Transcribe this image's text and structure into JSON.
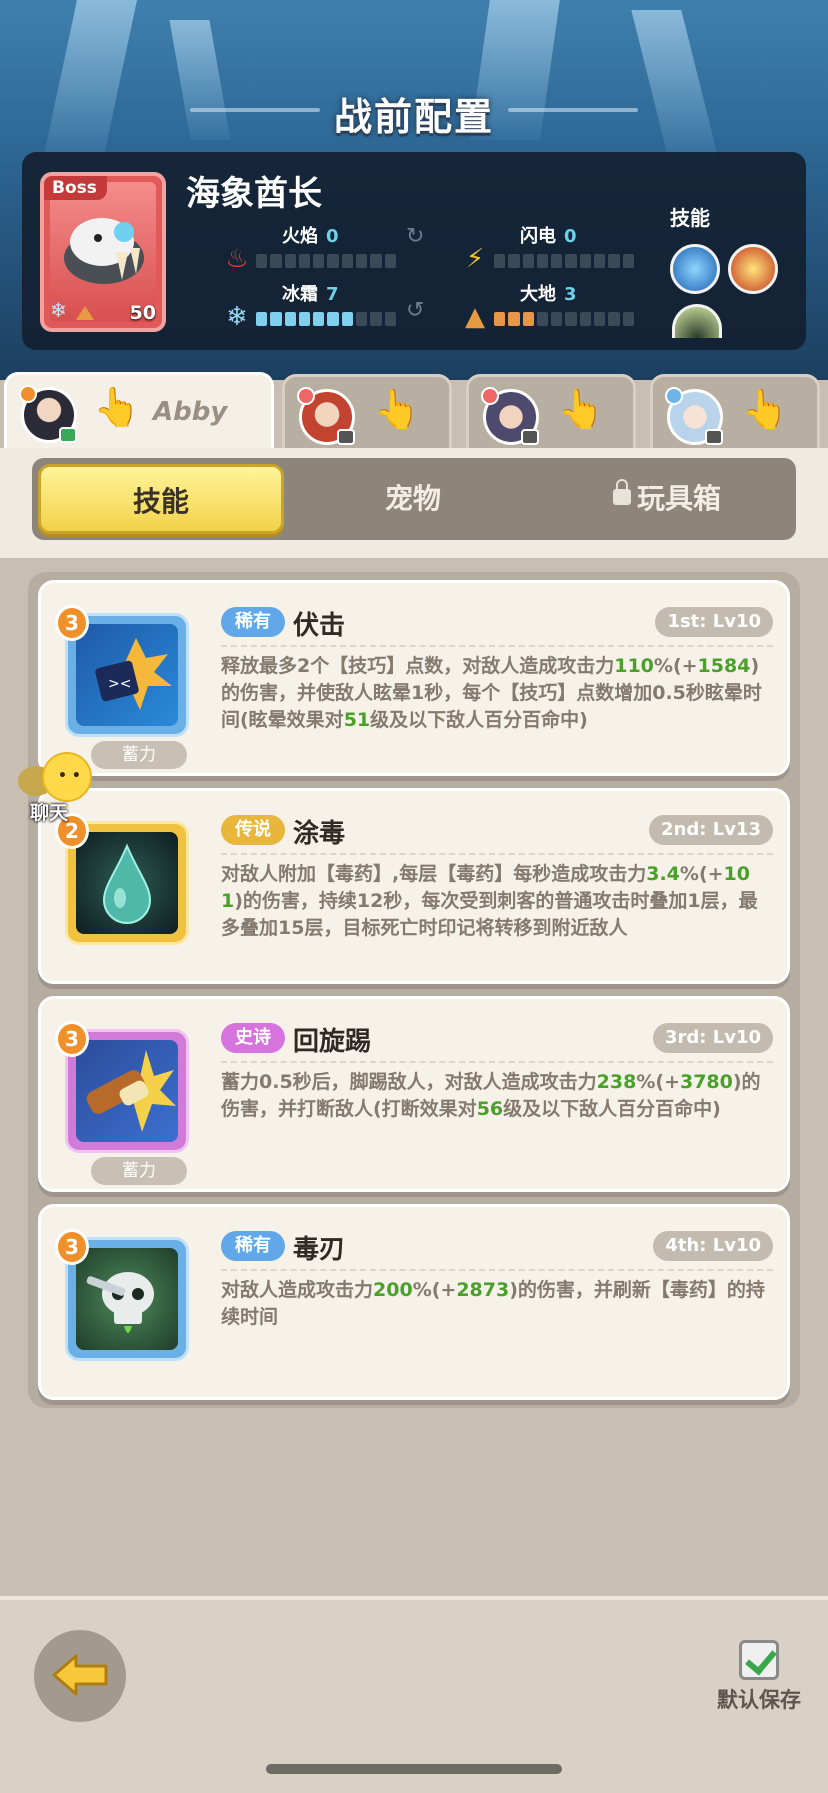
{
  "screen": {
    "title": "战前配置"
  },
  "boss": {
    "tag": "Boss",
    "name": "海象酋长",
    "level": "50",
    "skills_label": "技能",
    "stats": {
      "fire": {
        "label": "火焰",
        "value": "0",
        "pips_on": 0
      },
      "lightning": {
        "label": "闪电",
        "value": "0",
        "pips_on": 0
      },
      "frost": {
        "label": "冰霜",
        "value": "7",
        "pips_on": 7
      },
      "earth": {
        "label": "大地",
        "value": "3",
        "pips_on": 3
      }
    }
  },
  "heroes": [
    {
      "name": "Abby",
      "active": true
    },
    {
      "name": "",
      "active": false
    },
    {
      "name": "",
      "active": false
    },
    {
      "name": "",
      "active": false
    }
  ],
  "tabs": {
    "skills": "技能",
    "pets": "宠物",
    "toybox": "玩具箱"
  },
  "chat": {
    "label": "聊天"
  },
  "skills": [
    {
      "tier": "3",
      "rarity": "稀有",
      "rarity_color": "#62a8e8",
      "name": "伏击",
      "slot": "1st: Lv10",
      "charge": "蓄力",
      "desc_parts": [
        "释放最多2个【技巧】点数，对敌人造成攻击力",
        "110",
        "%(+",
        "1584",
        ")的伤害，并使敌人眩晕1秒，每个【技巧】点数增加0.5秒眩晕时间(眩晕效果对",
        "51",
        "级及以下敌人百分百命中)"
      ]
    },
    {
      "tier": "2",
      "rarity": "传说",
      "rarity_color": "#e9b63c",
      "name": "涂毒",
      "slot": "2nd: Lv13",
      "charge": "",
      "desc_parts": [
        "对敌人附加【毒药】,每层【毒药】每秒造成攻击力",
        "3.4",
        "%(+",
        "101",
        ")的伤害，持续12秒，每次受到刺客的普通攻击时叠加1层，最多叠加15层，目标死亡时印记将转移到附近敌人",
        "",
        ""
      ]
    },
    {
      "tier": "3",
      "rarity": "史诗",
      "rarity_color": "#d673dc",
      "name": "回旋踢",
      "slot": "3rd: Lv10",
      "charge": "蓄力",
      "desc_parts": [
        "蓄力0.5秒后，脚踢敌人，对敌人造成攻击力",
        "238",
        "%(+",
        "3780",
        ")的伤害，并打断敌人(打断效果对",
        "56",
        "级及以下敌人百分百命中)"
      ]
    },
    {
      "tier": "3",
      "rarity": "稀有",
      "rarity_color": "#62a8e8",
      "name": "毒刃",
      "slot": "4th: Lv10",
      "charge": "",
      "desc_parts": [
        "对敌人造成攻击力",
        "200",
        "%(+",
        "2873",
        ")的伤害，并刷新【毒药】的持续时间",
        "",
        ""
      ]
    }
  ],
  "footer": {
    "save_label": "默认保存",
    "save_checked": true
  },
  "icons": {
    "back": "back-arrow-icon",
    "fire": "fire-icon",
    "lightning": "lightning-icon",
    "frost": "snowflake-icon",
    "earth": "earth-icon",
    "lock": "lock-icon",
    "tap": "tap-hand-icon"
  }
}
